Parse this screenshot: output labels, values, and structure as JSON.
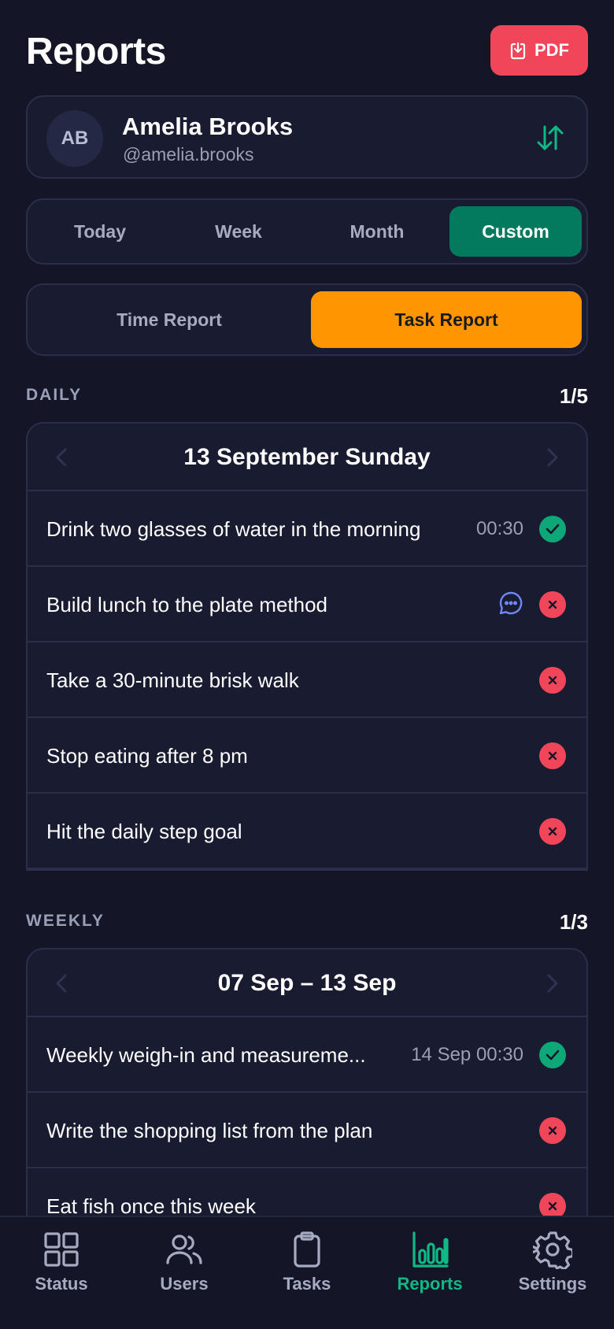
{
  "header": {
    "title": "Reports",
    "pdf_label": "PDF"
  },
  "profile": {
    "initials": "AB",
    "name": "Amelia Brooks",
    "handle": "@amelia.brooks"
  },
  "range_tabs": [
    {
      "label": "Today",
      "active": false
    },
    {
      "label": "Week",
      "active": false
    },
    {
      "label": "Month",
      "active": false
    },
    {
      "label": "Custom",
      "active": true
    }
  ],
  "report_tabs": [
    {
      "label": "Time Report",
      "active": false
    },
    {
      "label": "Task Report",
      "active": true
    }
  ],
  "daily": {
    "label": "DAILY",
    "count": "1/5",
    "date": "13 September Sunday",
    "tasks": [
      {
        "text": "Drink two glasses of water in the morning",
        "time": "00:30",
        "status": "done"
      },
      {
        "text": "Build lunch to the plate method",
        "time": "",
        "status": "fail",
        "has_comment": true
      },
      {
        "text": "Take a 30-minute brisk walk",
        "time": "",
        "status": "fail"
      },
      {
        "text": "Stop eating after 8 pm",
        "time": "",
        "status": "fail"
      },
      {
        "text": "Hit the daily step goal",
        "time": "",
        "status": "fail"
      }
    ]
  },
  "weekly": {
    "label": "WEEKLY",
    "count": "1/3",
    "date": "07 Sep – 13 Sep",
    "tasks": [
      {
        "text": "Weekly weigh-in and measureme...",
        "time": "14 Sep 00:30",
        "status": "done"
      },
      {
        "text": "Write the shopping list from the plan",
        "time": "",
        "status": "fail"
      },
      {
        "text": "Eat fish once this week",
        "time": "",
        "status": "fail"
      }
    ]
  },
  "bottom_nav": [
    {
      "label": "Status",
      "icon": "grid-icon",
      "active": false
    },
    {
      "label": "Users",
      "icon": "users-icon",
      "active": false
    },
    {
      "label": "Tasks",
      "icon": "clipboard-icon",
      "active": false
    },
    {
      "label": "Reports",
      "icon": "bar-chart-icon",
      "active": true
    },
    {
      "label": "Settings",
      "icon": "gear-icon",
      "active": false
    }
  ],
  "colors": {
    "background": "#141627",
    "card": "#191b30",
    "accent_green": "#037a5e",
    "accent_orange": "#ff9500",
    "danger": "#f1465a",
    "success": "#0ea878",
    "nav_active": "#10b886"
  }
}
